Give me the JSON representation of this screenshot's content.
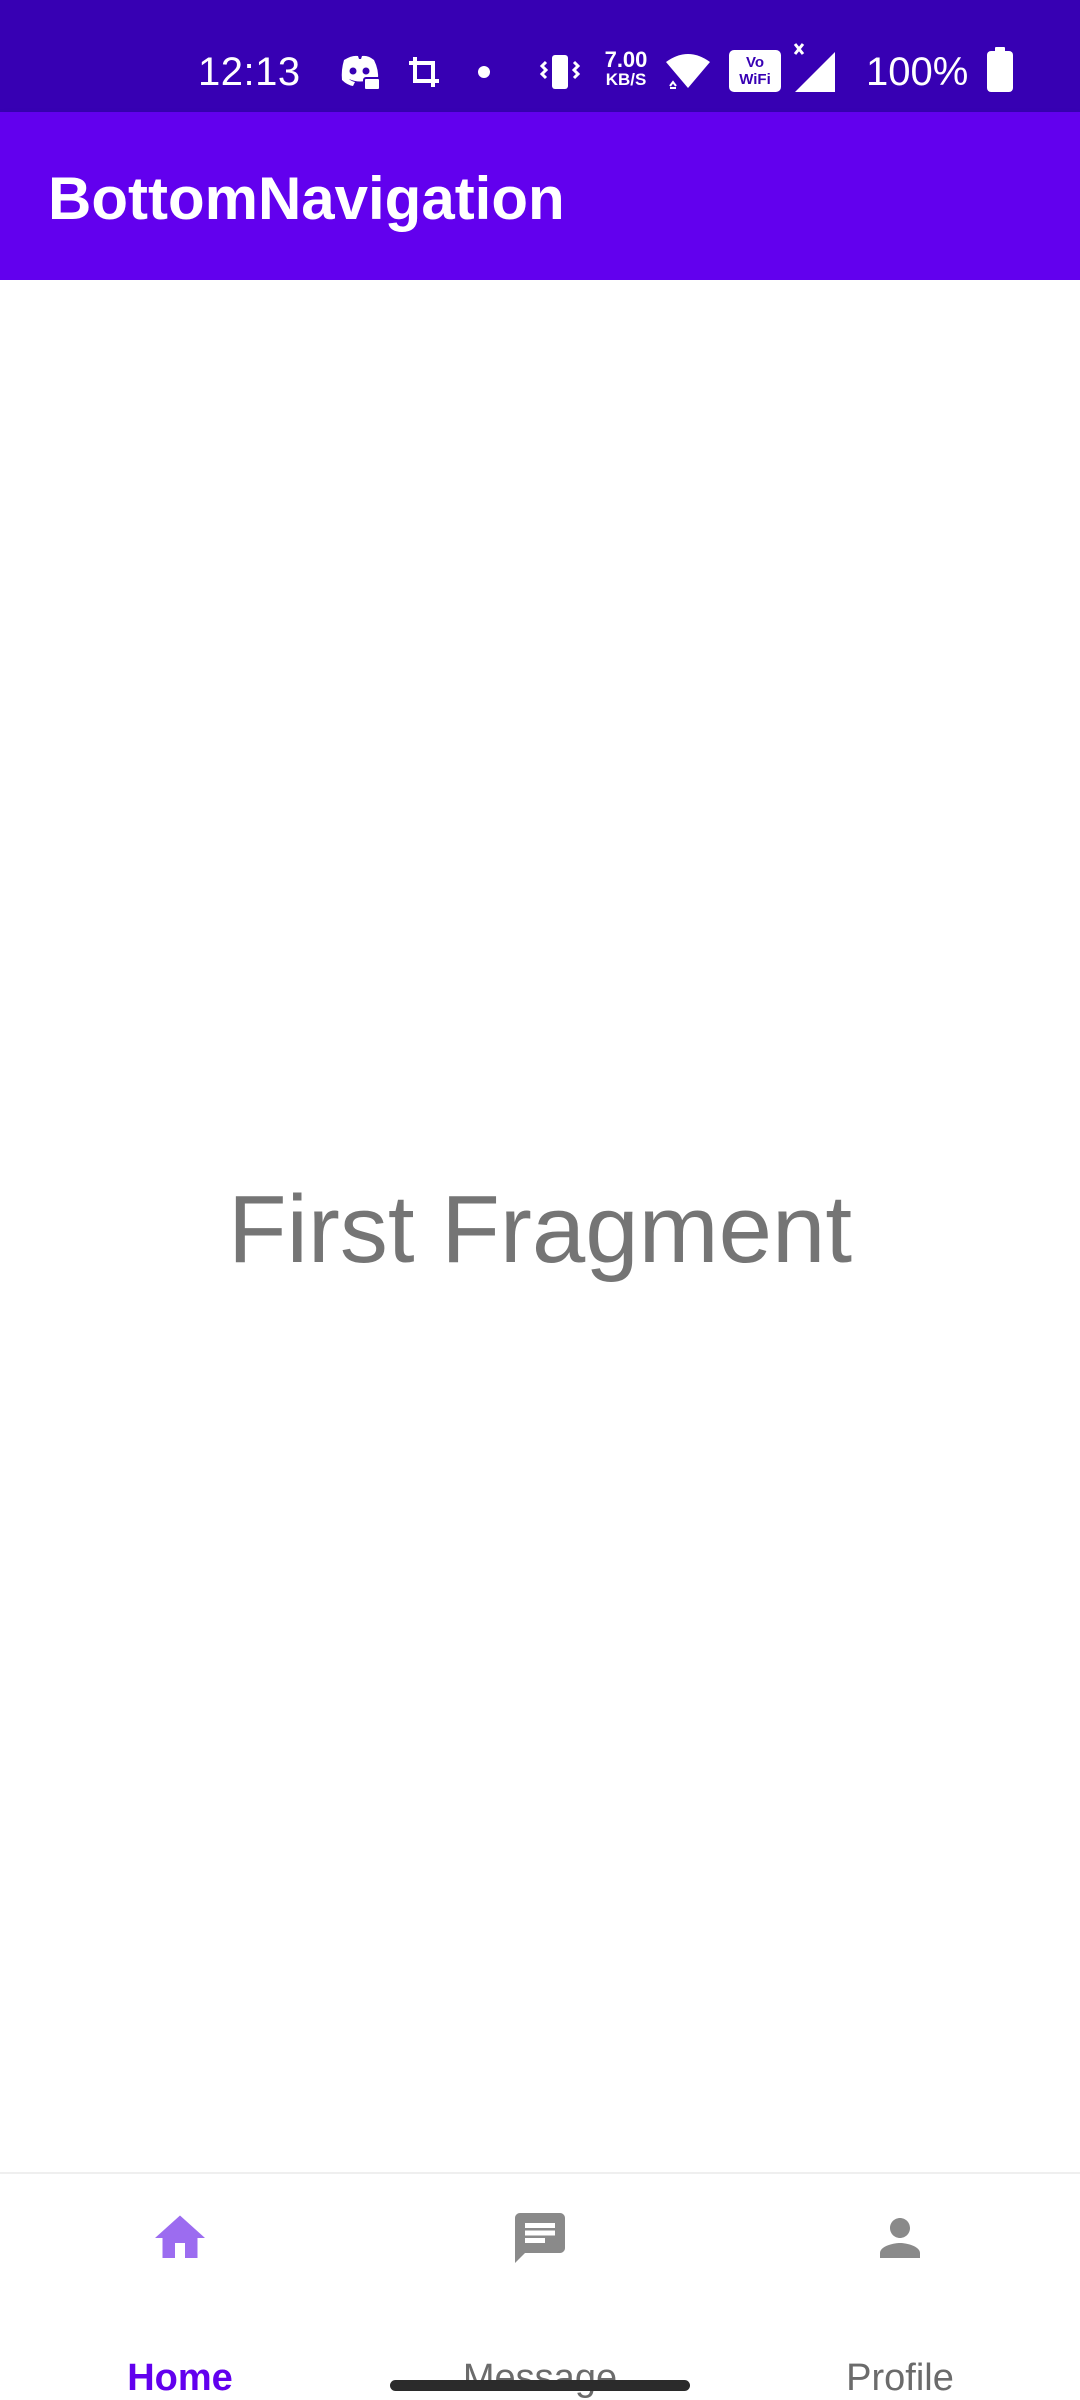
{
  "status_bar": {
    "time": "12:13",
    "net_speed_value": "7.00",
    "net_speed_unit": "KB/S",
    "volte_top": "Vo",
    "volte_bottom": "WiFi",
    "battery_percent": "100%",
    "icons": [
      "discord-icon",
      "crop-icon",
      "dot-icon",
      "vibrate-icon",
      "wifi-icon",
      "vowifi-icon",
      "signal-icon",
      "battery-icon"
    ],
    "background_color": "#3700b3"
  },
  "app_bar": {
    "title": "BottomNavigation",
    "background_color": "#6200ee"
  },
  "content": {
    "fragment_text": "First Fragment"
  },
  "bottom_nav": {
    "items": [
      {
        "label": "Home",
        "icon": "home-icon",
        "active": true
      },
      {
        "label": "Message",
        "icon": "message-icon",
        "active": false
      },
      {
        "label": "Profile",
        "icon": "person-icon",
        "active": false
      }
    ],
    "active_color": "#6200ee",
    "active_icon_color": "#9c6cf0",
    "inactive_color": "#8a8a8a"
  }
}
